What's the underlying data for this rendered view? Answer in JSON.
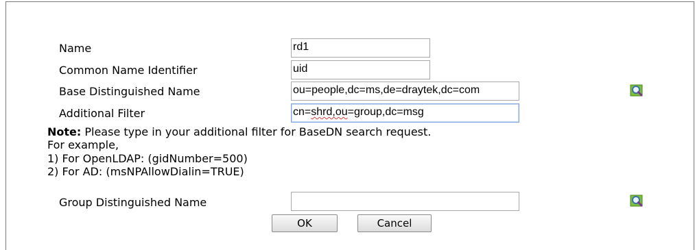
{
  "form": {
    "name": {
      "label": "Name",
      "value": "rd1"
    },
    "common_name_identifier": {
      "label": "Common Name Identifier",
      "value": "uid"
    },
    "base_dn": {
      "label": "Base Distinguished Name",
      "value": "ou=people,dc=ms,de=draytek,dc=com"
    },
    "additional_filter": {
      "label": "Additional Filter",
      "value_part1": "cn=",
      "value_misspelled": "shrd,ou",
      "value_part2": "=group,dc=msg"
    },
    "note": {
      "bold": "Note:",
      "text": " Please type in your additional filter for BaseDN search request.",
      "line2": "For example,",
      "line3": "1) For OpenLDAP: (gidNumber=500)",
      "line4": "2) For AD: (msNPAllowDialin=TRUE)"
    },
    "group_dn": {
      "label": "Group Distinguished Name",
      "value": ""
    }
  },
  "buttons": {
    "ok": "OK",
    "cancel": "Cancel"
  },
  "icons": {
    "search_icon_1": "magnifier-search-icon",
    "search_icon_2": "magnifier-search-icon"
  }
}
